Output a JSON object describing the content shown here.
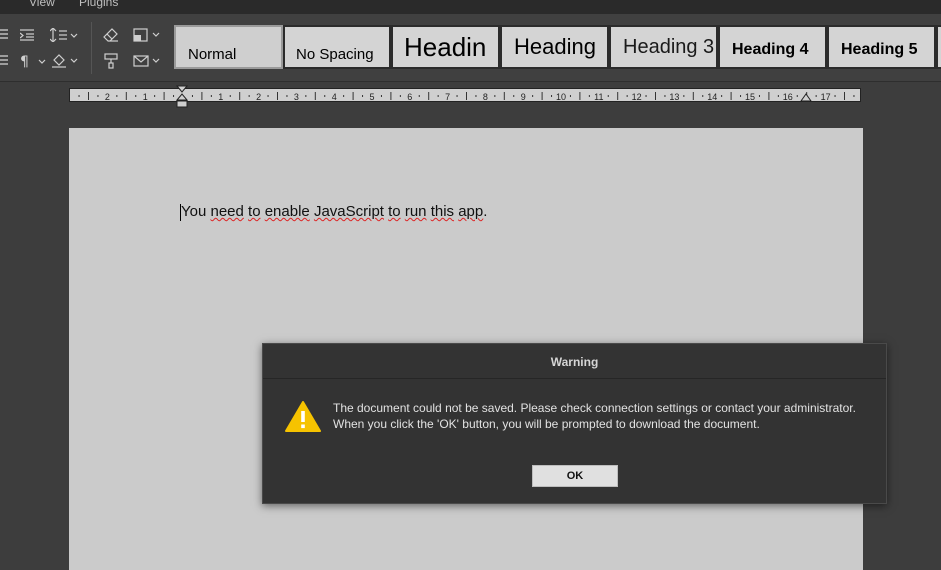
{
  "menubar": {
    "items": [
      "View",
      "Plugins"
    ]
  },
  "toolbar": {
    "icons": [
      "align-justify-icon",
      "increase-indent-icon",
      "line-spacing-icon",
      "eraser-icon",
      "shading-icon",
      "paragraph-marks-icon",
      "fill-color-icon",
      "copy-style-icon",
      "insert-shape-icon"
    ],
    "styles": [
      "Normal",
      "No Spacing",
      "Headin",
      "Heading",
      "Heading 3",
      "Heading 4",
      "Heading 5"
    ]
  },
  "ruler": {
    "numbers": [
      "2",
      "1",
      "1",
      "2",
      "3",
      "4",
      "5",
      "6",
      "7",
      "8",
      "9",
      "10",
      "11",
      "12",
      "13",
      "14",
      "15",
      "16",
      "17"
    ]
  },
  "document": {
    "words": [
      "You",
      "need",
      "to",
      "enable",
      "JavaScript",
      "to",
      "run",
      "this",
      "app",
      "."
    ]
  },
  "dialog": {
    "title": "Warning",
    "line1": "The document could not be saved. Please check connection settings or contact your administrator.",
    "line2": "When you click the 'OK' button, you will be prompted to download the document.",
    "ok_label": "OK",
    "warning_color": "#f6c300"
  }
}
